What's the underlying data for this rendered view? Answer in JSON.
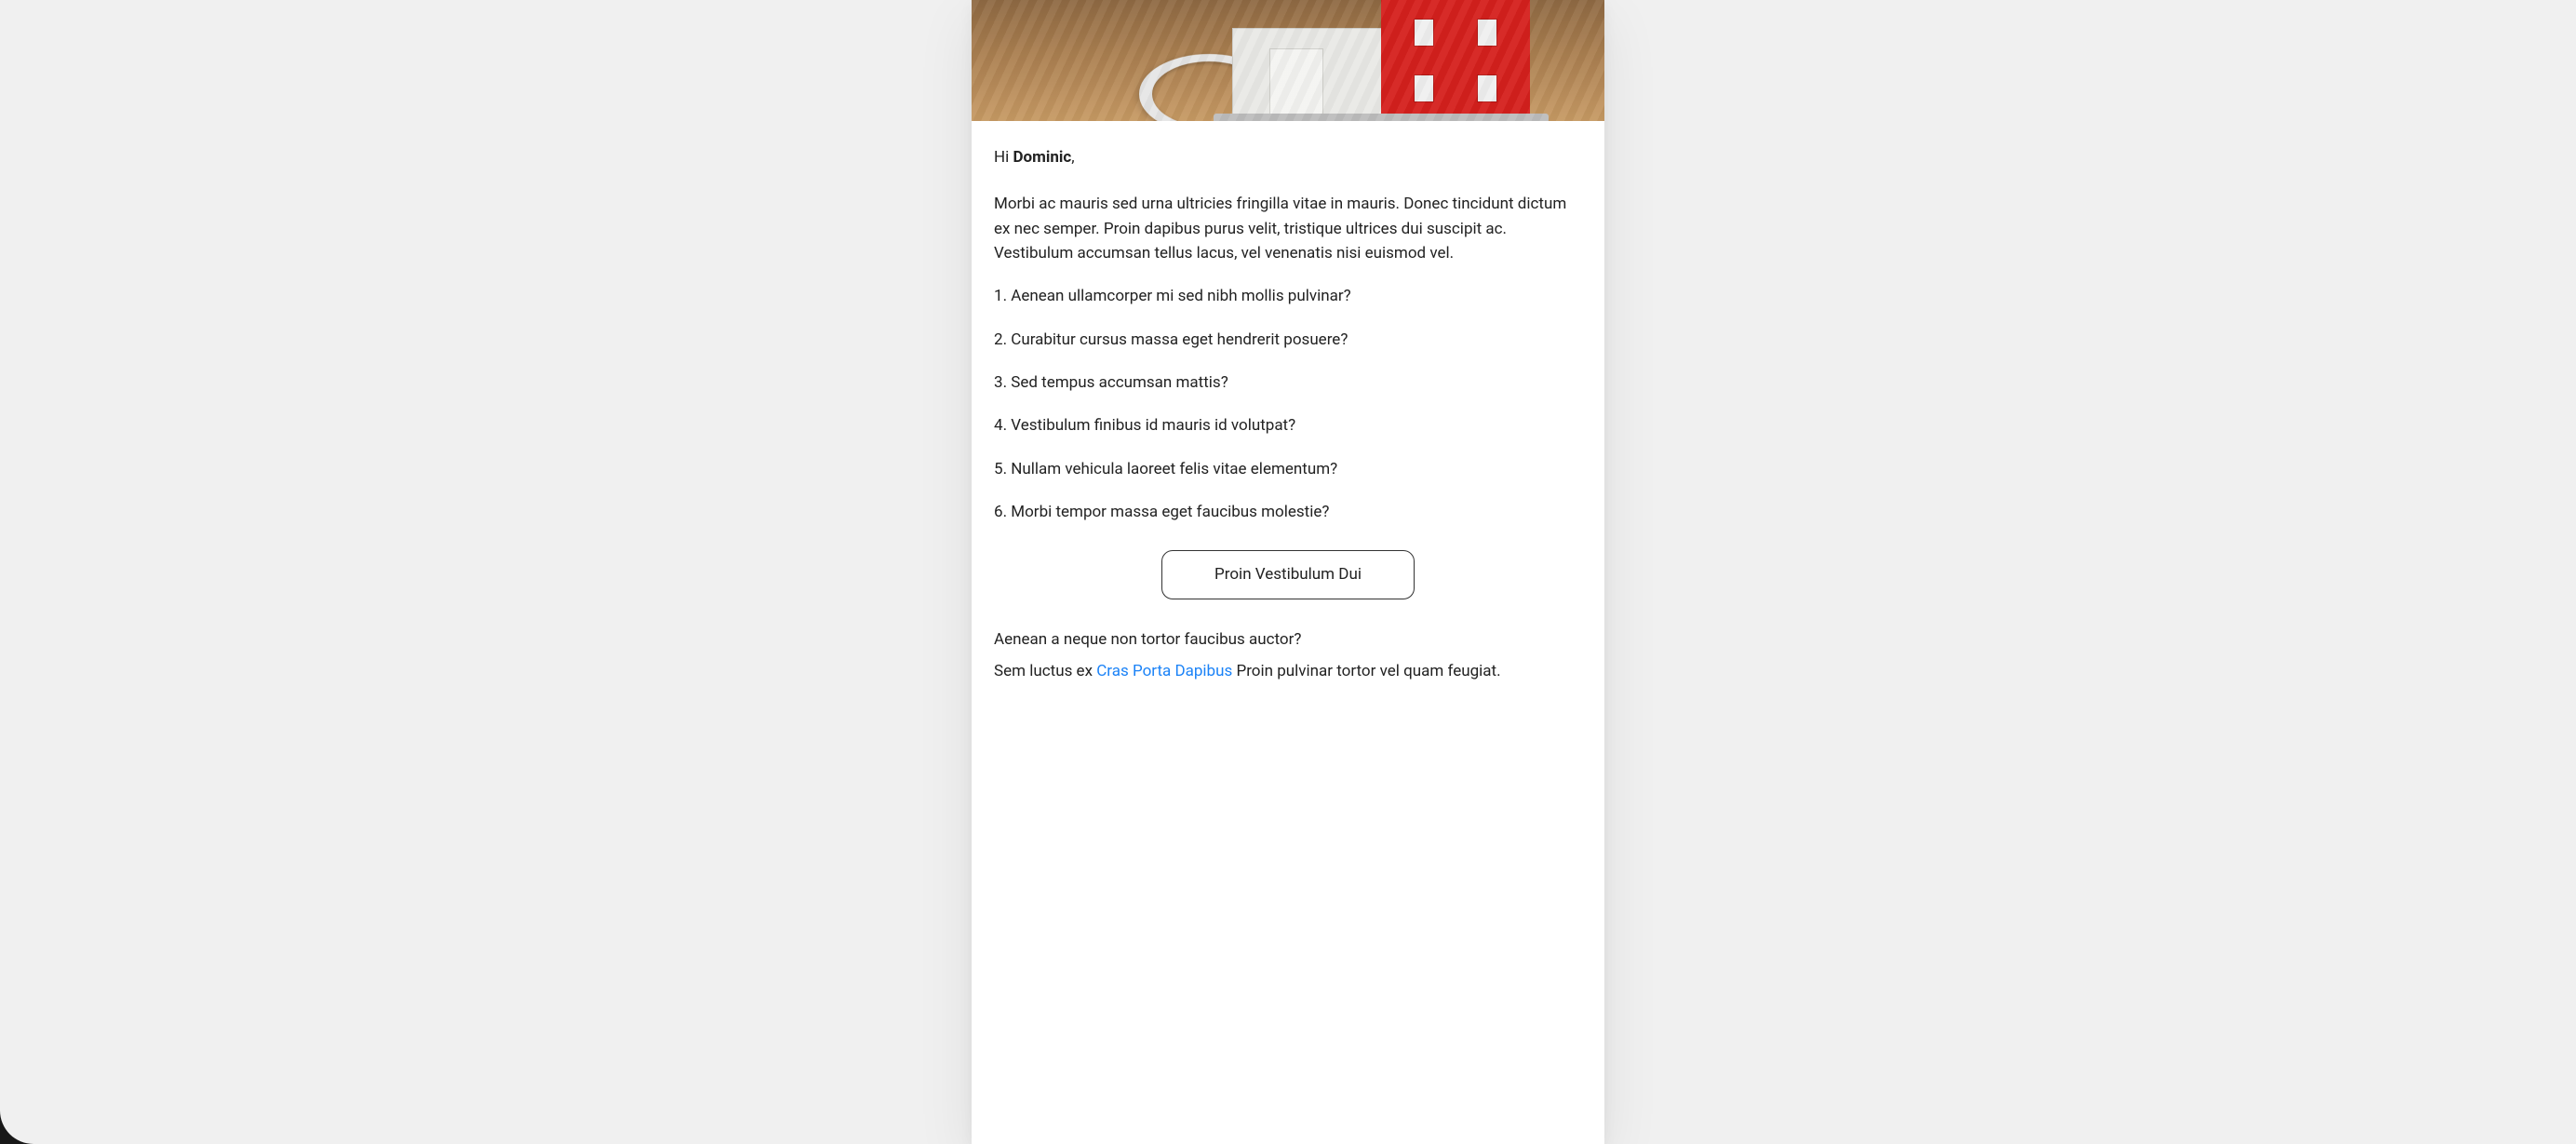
{
  "greeting": {
    "prefix": "Hi ",
    "name": "Dominic",
    "suffix": ","
  },
  "intro": "Morbi ac mauris sed urna ultricies fringilla vitae in mauris. Donec tincidunt dictum ex nec semper. Proin dapibus purus velit, tristique ultrices dui suscipit ac. Vestibulum accumsan tellus lacus, vel venenatis nisi euismod vel.",
  "questions": [
    "Aenean ullamcorper mi sed nibh mollis pulvinar?",
    "Curabitur cursus massa eget hendrerit posuere?",
    "Sed tempus accumsan mattis?",
    "Vestibulum finibus id mauris id volutpat?",
    "Nullam vehicula laoreet felis vitae elementum?",
    "Morbi tempor massa eget faucibus molestie?"
  ],
  "cta": {
    "label": "Proin Vestibulum Dui"
  },
  "followup": {
    "line1": "Aenean a neque non tortor faucibus auctor?",
    "line2_pre": "Sem luctus ex ",
    "line2_link": "Cras Porta Dapibus",
    "line2_post": " Proin pulvinar tortor vel quam feugiat."
  }
}
